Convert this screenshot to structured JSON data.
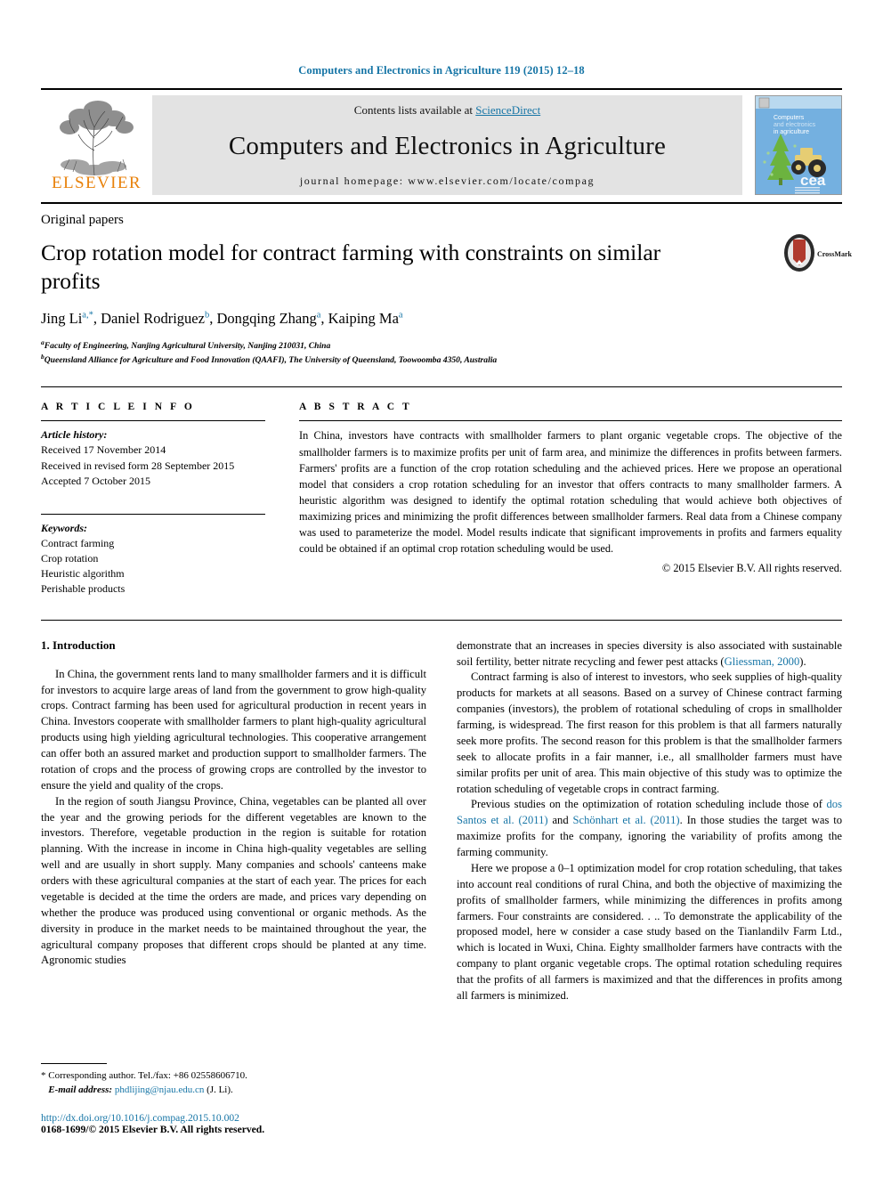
{
  "running_head": "Computers and Electronics in Agriculture 119 (2015) 12–18",
  "masthead": {
    "publisher_logo_text": "ELSEVIER",
    "contents_prefix": "Contents lists available at ",
    "contents_link": "ScienceDirect",
    "journal_title": "Computers and Electronics in Agriculture",
    "homepage_line": "journal homepage: www.elsevier.com/locate/compag",
    "cover_title_lines": [
      "Computers",
      "and electronics",
      "in agriculture"
    ],
    "cover_mark": "cea",
    "link_color": "#1675a6"
  },
  "title_block": {
    "section_kind": "Original papers",
    "title": "Crop rotation model for contract farming with constraints on similar profits",
    "crossmark_label": "CrossMark",
    "authors": [
      {
        "name": "Jing Li",
        "marks": "a,*"
      },
      {
        "name": "Daniel Rodriguez",
        "marks": "b"
      },
      {
        "name": "Dongqing Zhang",
        "marks": "a"
      },
      {
        "name": "Kaiping Ma",
        "marks": "a"
      }
    ],
    "affiliations": [
      {
        "mark": "a",
        "text": "Faculty of Engineering, Nanjing Agricultural University, Nanjing 210031, China"
      },
      {
        "mark": "b",
        "text": "Queensland Alliance for Agriculture and Food Innovation (QAAFI), The University of Queensland, Toowoomba 4350, Australia"
      }
    ]
  },
  "article_info": {
    "heading": "A R T I C L E   I N F O",
    "history_label": "Article history:",
    "history": [
      "Received 17 November 2014",
      "Received in revised form 28 September 2015",
      "Accepted 7 October 2015"
    ],
    "keywords_label": "Keywords:",
    "keywords": [
      "Contract farming",
      "Crop rotation",
      "Heuristic algorithm",
      "Perishable products"
    ]
  },
  "abstract": {
    "heading": "A B S T R A C T",
    "text": "In China, investors have contracts with smallholder farmers to plant organic vegetable crops. The objective of the smallholder farmers is to maximize profits per unit of farm area, and minimize the differences in profits between farmers. Farmers' profits are a function of the crop rotation scheduling and the achieved prices. Here we propose an operational model that considers a crop rotation scheduling for an investor that offers contracts to many smallholder farmers. A heuristic algorithm was designed to identify the optimal rotation scheduling that would achieve both objectives of maximizing prices and minimizing the profit differences between smallholder farmers. Real data from a Chinese company was used to parameterize the model. Model results indicate that significant improvements in profits and farmers equality could be obtained if an optimal crop rotation scheduling would be used.",
    "copyright": "© 2015 Elsevier B.V. All rights reserved."
  },
  "body": {
    "section_number_title": "1. Introduction",
    "left_paragraphs": [
      "In China, the government rents land to many smallholder farmers and it is difficult for investors to acquire large areas of land from the government to grow high-quality crops. Contract farming has been used for agricultural production in recent years in China. Investors cooperate with smallholder farmers to plant high-quality agricultural products using high yielding agricultural technologies. This cooperative arrangement can offer both an assured market and production support to smallholder farmers. The rotation of crops and the process of growing crops are controlled by the investor to ensure the yield and quality of the crops.",
      "In the region of south Jiangsu Province, China, vegetables can be planted all over the year and the growing periods for the different vegetables are known to the investors. Therefore, vegetable production in the region is suitable for rotation planning. With the increase in income in China high-quality vegetables are selling well and are usually in short supply. Many companies and schools' canteens make orders with these agricultural companies at the start of each year. The prices for each vegetable is decided at the time the orders are made, and prices vary depending on whether the produce was produced using conventional or organic methods. As the diversity in produce in the market needs to be maintained throughout the year, the agricultural company proposes that different crops should be planted at any time. Agronomic studies"
    ],
    "right_paragraphs": [
      {
        "indent": false,
        "segments": [
          {
            "t": "demonstrate that an increases in species diversity is also associated with sustainable soil fertility, better nitrate recycling and fewer pest attacks (",
            "link": false
          },
          {
            "t": "Gliessman, 2000",
            "link": true
          },
          {
            "t": ").",
            "link": false
          }
        ]
      },
      {
        "indent": true,
        "segments": [
          {
            "t": "Contract farming is also of interest to investors, who seek supplies of high-quality products for markets at all seasons. Based on a survey of Chinese contract farming companies (investors), the problem of rotational scheduling of crops in smallholder farming, is widespread. The first reason for this problem is that all farmers naturally seek more profits. The second reason for this problem is that the smallholder farmers seek to allocate profits in a fair manner, i.e., all smallholder farmers must have similar profits per unit of area. This main objective of this study was to optimize the rotation scheduling of vegetable crops in contract farming.",
            "link": false
          }
        ]
      },
      {
        "indent": true,
        "segments": [
          {
            "t": "Previous studies on the optimization of rotation scheduling include those of ",
            "link": false
          },
          {
            "t": "dos Santos et al. (2011)",
            "link": true
          },
          {
            "t": " and ",
            "link": false
          },
          {
            "t": "Schönhart et al. (2011)",
            "link": true
          },
          {
            "t": ". In those studies the target was to maximize profits for the company, ignoring the variability of profits among the farming community.",
            "link": false
          }
        ]
      },
      {
        "indent": true,
        "segments": [
          {
            "t": "Here we propose a 0–1 optimization model for crop rotation scheduling, that takes into account real conditions of rural China, and both the objective of maximizing the profits of smallholder farmers, while minimizing the differences in profits among farmers. Four constraints are considered. . .. To demonstrate the applicability of the proposed model, here w consider a case study based on the Tianlandilv Farm Ltd., which is located in Wuxi, China. Eighty smallholder farmers have contracts with the company to plant organic vegetable crops. The optimal rotation scheduling requires that the profits of all farmers is maximized and that the differences in profits among all farmers is minimized.",
            "link": false
          }
        ]
      }
    ]
  },
  "footnotes": {
    "corresponding": "* Corresponding author. Tel./fax: +86 02558606710.",
    "email_label": "E-mail address:",
    "email": "phdlijing@njau.edu.cn",
    "email_suffix": "(J. Li).",
    "doi": "http://dx.doi.org/10.1016/j.compag.2015.10.002",
    "issn": "0168-1699/© 2015 Elsevier B.V. All rights reserved."
  }
}
